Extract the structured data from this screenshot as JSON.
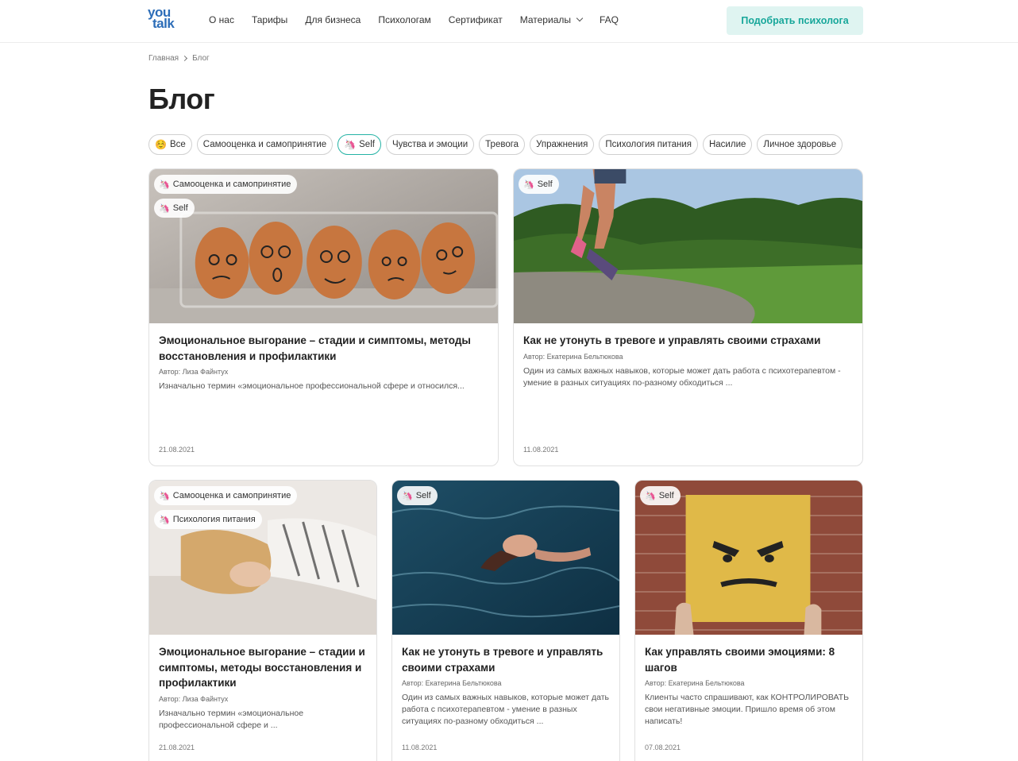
{
  "header": {
    "logo_line1": "you",
    "logo_line2": "talk",
    "nav": [
      "О нас",
      "Тарифы",
      "Для бизнеса",
      "Психологам",
      "Сертификат",
      "Материалы",
      "FAQ"
    ],
    "cta_label": "Подобрать психолога"
  },
  "breadcrumb": {
    "home": "Главная",
    "current": "Блог"
  },
  "page_title": "Блог",
  "filters": [
    {
      "emoji": "☺️",
      "label": "Все"
    },
    {
      "label": "Самооценка и самопринятие"
    },
    {
      "emoji": "🦄",
      "label": "Self"
    },
    {
      "label": "Чувства и эмоции"
    },
    {
      "label": "Тревога"
    },
    {
      "label": "Упражнения"
    },
    {
      "label": "Психология питания"
    },
    {
      "label": "Насилие"
    },
    {
      "label": "Личное здоровье"
    }
  ],
  "tag_emoji": "🦄",
  "cards": [
    {
      "image": "eggs-with-faces",
      "tags": [
        "Самооценка и самопринятие",
        "Self"
      ],
      "title": "Эмоциональное выгорание – стадии и симптомы, методы восстановления и профилактики",
      "author": "Автор: Лиза Файнтух",
      "excerpt": "Изначально термин «эмоциональное профессиональной сфере и относился...",
      "date": "21.08.2021"
    },
    {
      "image": "runner-on-path",
      "tags": [
        "Self"
      ],
      "title": "Как не утонуть в тревоге и управлять своими страхами",
      "author": "Автор: Екатерина Бельтюкова",
      "excerpt": "Один из самых важных навыков, которые может дать работа с психотерапевтом - умение в разных ситуациях по-разному обходиться ...",
      "date": "11.08.2021"
    },
    {
      "image": "woman-lying-in-bed",
      "tags": [
        "Самооценка и самопринятие",
        "Психология питания"
      ],
      "title": "Эмоциональное выгорание – стадии и симптомы, методы восстановления и профилактики",
      "author": "Автор: Лиза Файнтух",
      "excerpt": "Изначально термин «эмоциональное профессиональной сфере и ...",
      "date": "21.08.2021"
    },
    {
      "image": "woman-floating-in-water",
      "tags": [
        "Self"
      ],
      "title": "Как не утонуть в тревоге и управлять своими страхами",
      "author": "Автор: Екатерина Бельтюкова",
      "excerpt": "Один из самых важных навыков, которые может дать работа с психотерапевтом - умение в разных ситуациях по-разному обходиться ...",
      "date": "11.08.2021"
    },
    {
      "image": "angry-face-sign-on-brick-wall",
      "tags": [
        "Self"
      ],
      "title": "Как управлять своими эмоциями: 8 шагов",
      "author": "Автор: Екатерина Бельтюкова",
      "excerpt": "Клиенты часто спрашивают, как КОНТРОЛИРОВАТЬ свои негативные эмоции. Пришло время об этом написать!",
      "date": "07.08.2021"
    }
  ],
  "colors": {
    "accent": "#25b3a5",
    "cta_bg": "#dff4f1",
    "logo": "#2c6db8"
  }
}
